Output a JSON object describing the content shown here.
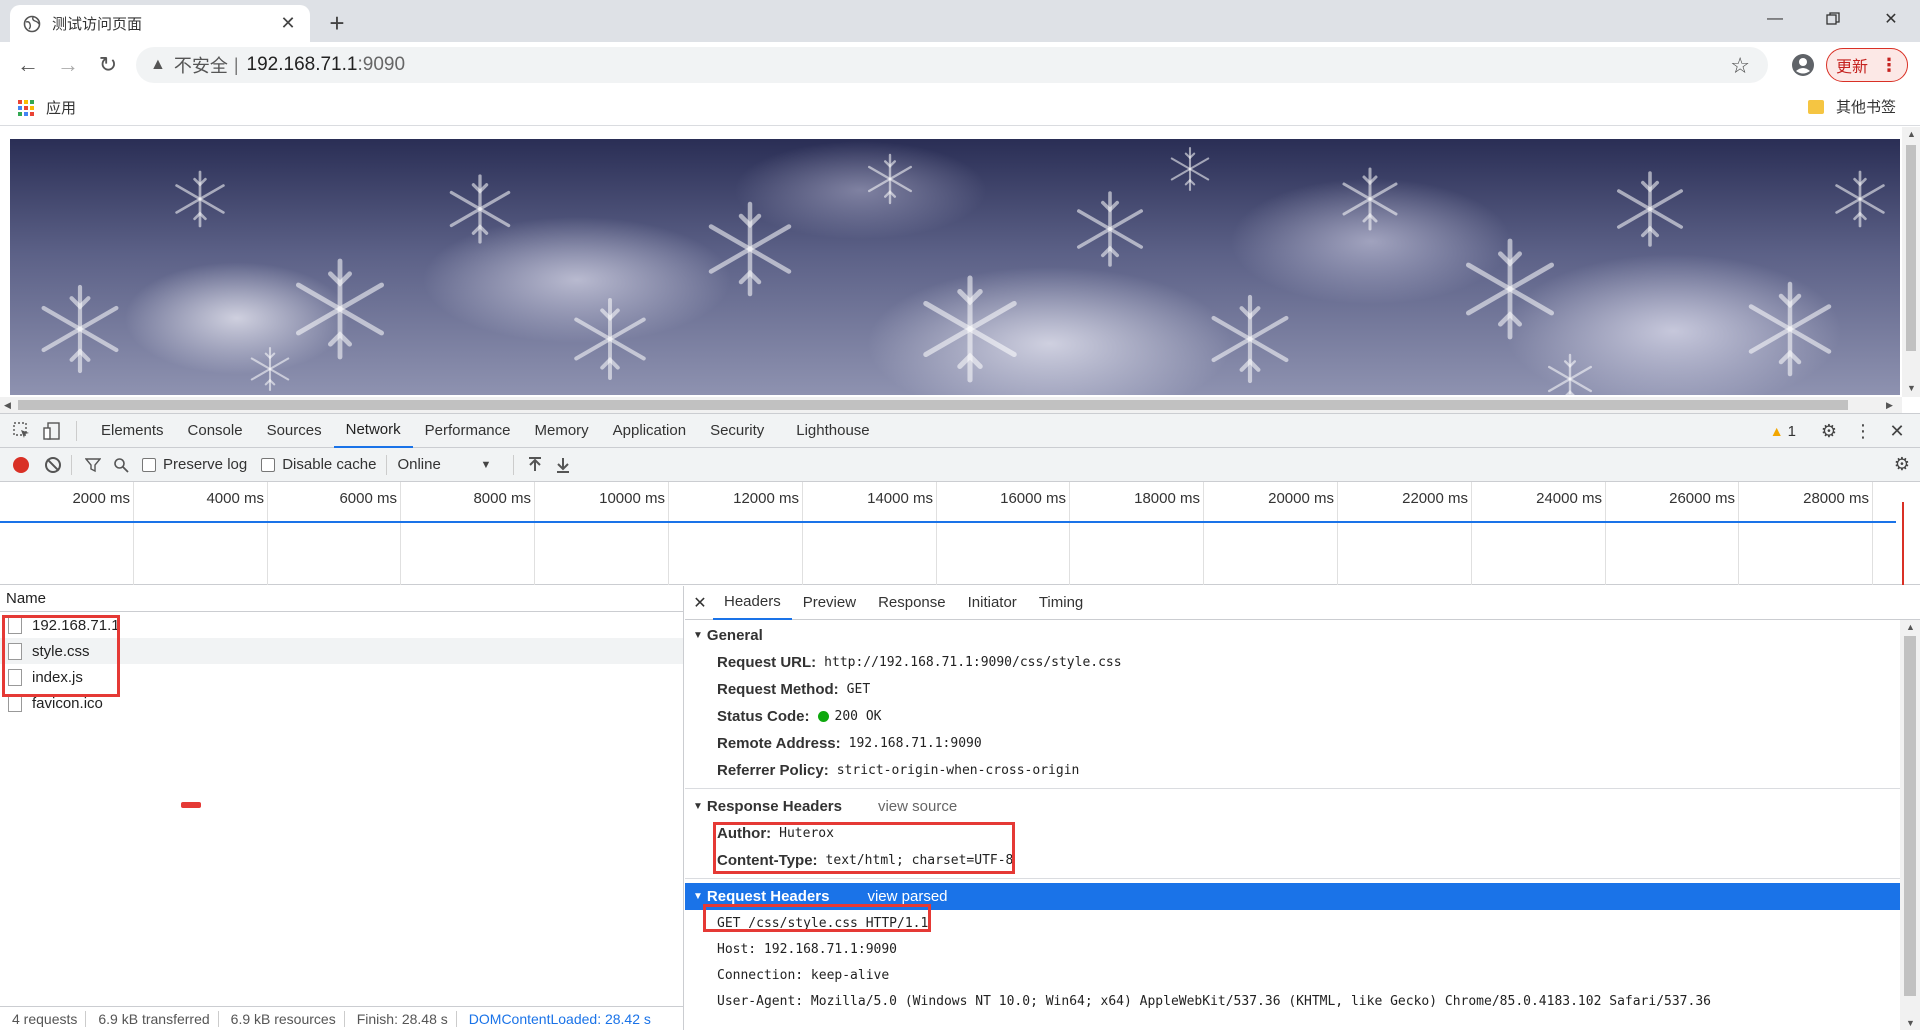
{
  "browser": {
    "tab_title": "测试访问页面",
    "omnibox": {
      "security_label": "不安全",
      "separator": "|",
      "host": "192.168.71.1",
      "port": ":9090"
    },
    "update_label": "更新",
    "bookmarks": {
      "apps_label": "应用",
      "other_label": "其他书签"
    }
  },
  "devtools": {
    "tabs": [
      "Elements",
      "Console",
      "Sources",
      "Network",
      "Performance",
      "Memory",
      "Application",
      "Security",
      "Lighthouse"
    ],
    "active_tab": "Network",
    "warning_count": "1",
    "toolbar": {
      "preserve_log": "Preserve log",
      "disable_cache": "Disable cache",
      "throttling": "Online"
    },
    "timeline_ticks": [
      "2000 ms",
      "4000 ms",
      "6000 ms",
      "8000 ms",
      "10000 ms",
      "12000 ms",
      "14000 ms",
      "16000 ms",
      "18000 ms",
      "20000 ms",
      "22000 ms",
      "24000 ms",
      "26000 ms",
      "28000 ms"
    ],
    "requests": {
      "header": "Name",
      "items": [
        "192.168.71.1",
        "style.css",
        "index.js",
        "favicon.ico"
      ]
    },
    "status": {
      "requests": "4 requests",
      "transferred": "6.9 kB transferred",
      "resources": "6.9 kB resources",
      "finish": "Finish: 28.48 s",
      "dcl": "DOMContentLoaded: 28.42 s"
    },
    "details": {
      "tabs": [
        "Headers",
        "Preview",
        "Response",
        "Initiator",
        "Timing"
      ],
      "active_tab": "Headers",
      "general": {
        "title": "General",
        "request_url_k": "Request URL:",
        "request_url_v": "http://192.168.71.1:9090/css/style.css",
        "method_k": "Request Method:",
        "method_v": "GET",
        "status_k": "Status Code:",
        "status_v": "200 OK",
        "remote_k": "Remote Address:",
        "remote_v": "192.168.71.1:9090",
        "referrer_k": "Referrer Policy:",
        "referrer_v": "strict-origin-when-cross-origin"
      },
      "response_headers": {
        "title": "Response Headers",
        "link": "view source",
        "author_k": "Author:",
        "author_v": "Huterox",
        "ctype_k": "Content-Type:",
        "ctype_v": "text/html; charset=UTF-8"
      },
      "request_headers": {
        "title": "Request Headers",
        "link": "view parsed",
        "lines": [
          "GET /css/style.css HTTP/1.1",
          "Host: 192.168.71.1:9090",
          "Connection: keep-alive",
          "User-Agent: Mozilla/5.0 (Windows NT 10.0; Win64; x64) AppleWebKit/537.36 (KHTML, like Gecko) Chrome/85.0.4183.102 Safari/537.36"
        ]
      }
    }
  },
  "colors": {
    "accent": "#1a73e8",
    "highlight": "#e53935",
    "status_ok": "#0ea80e"
  }
}
